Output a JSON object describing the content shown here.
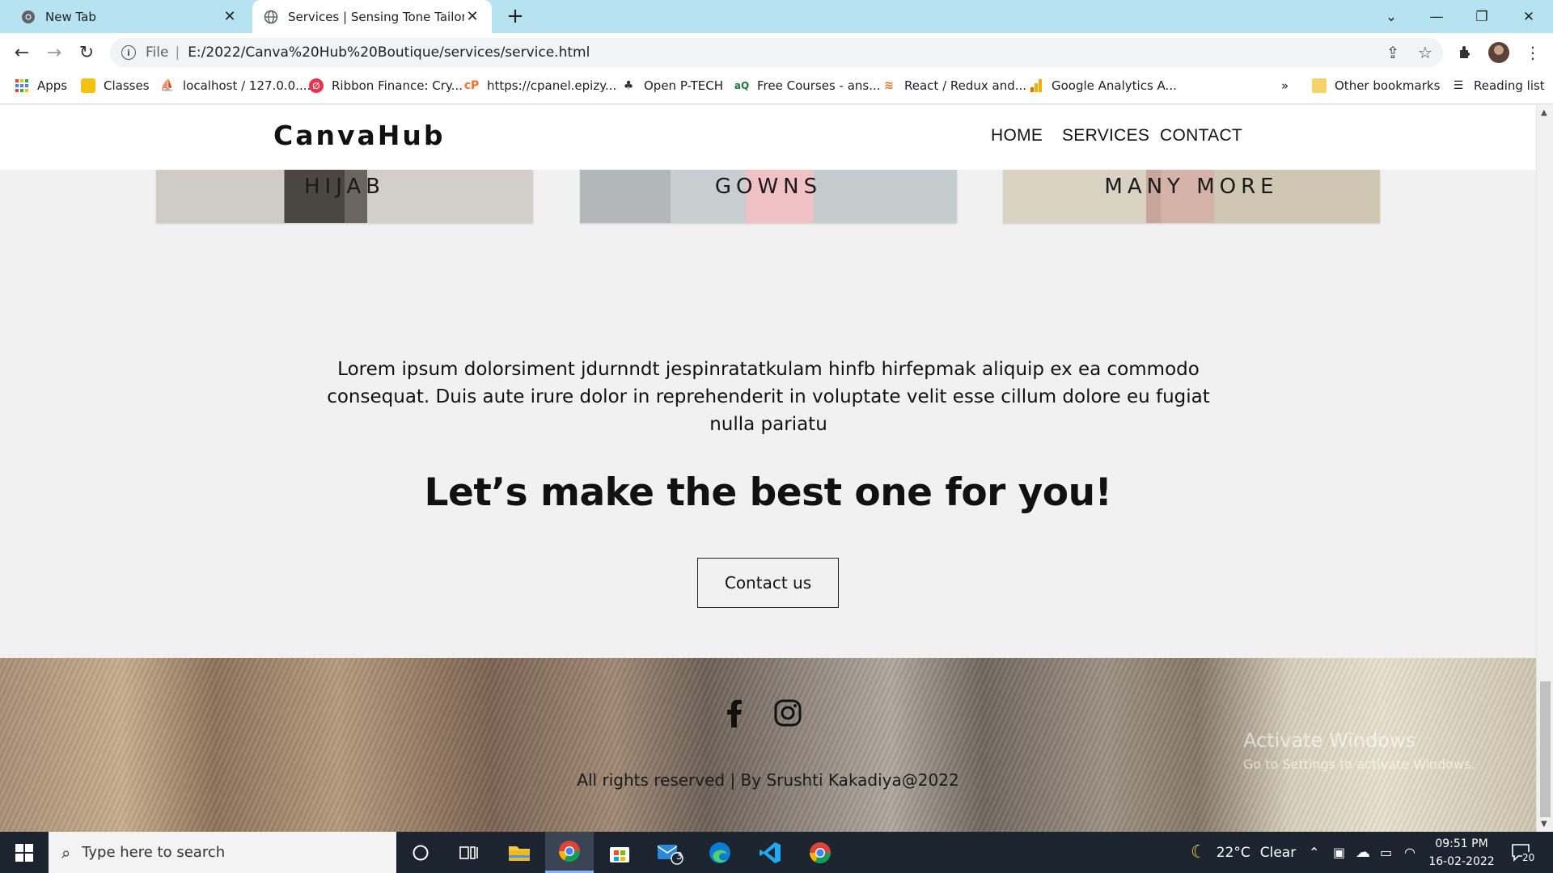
{
  "browser": {
    "tabs": [
      {
        "title": "New Tab",
        "active": false
      },
      {
        "title": "Services | Sensing Tone Tailors",
        "active": true
      }
    ],
    "address": {
      "scheme": "File",
      "url": "E:/2022/Canva%20Hub%20Boutique/services/service.html"
    },
    "bookmarks": [
      {
        "label": "Apps",
        "icon": "apps-grid-icon"
      },
      {
        "label": "Classes",
        "icon": "classes-icon"
      },
      {
        "label": "localhost / 127.0.0....",
        "icon": "phpmyadmin-icon"
      },
      {
        "label": "Ribbon Finance: Cry...",
        "icon": "ribbon-icon"
      },
      {
        "label": "https://cpanel.epizy...",
        "icon": "cpanel-icon"
      },
      {
        "label": "Open P-TECH",
        "icon": "ptech-icon"
      },
      {
        "label": "Free Courses - ans...",
        "icon": "courses-icon"
      },
      {
        "label": "React / Redux and...",
        "icon": "react-icon"
      },
      {
        "label": "Google Analytics A...",
        "icon": "analytics-icon"
      }
    ],
    "overflow": "»",
    "other_bookmarks": "Other bookmarks",
    "reading_list": "Reading list"
  },
  "site": {
    "logo": "CanvaHub",
    "nav": [
      "HOME",
      "SERVICES",
      "CONTACT"
    ],
    "cards": [
      "HIJAB",
      "GOWNS",
      "MANY MORE"
    ],
    "intro": "Lorem ipsum dolorsiment jdurnndt jespinratatkulam hinfb hirfepmak aliquip ex ea commodo consequat. Duis aute irure dolor in reprehenderit in voluptate velit esse cillum dolore eu fugiat nulla pariatu",
    "headline": "Let’s make the best one for you!",
    "cta": "Contact us",
    "footer": {
      "copyright": "All rights reserved | By Srushti Kakadiya@2022",
      "watermark_title": "Activate Windows",
      "watermark_sub": "Go to Settings to activate Windows."
    }
  },
  "taskbar": {
    "search_placeholder": "Type here to search",
    "mail_badge": "3",
    "weather": {
      "temp": "22°C",
      "condition": "Clear"
    },
    "time": "09:51 PM",
    "date": "16-02-2022",
    "notifications": "20"
  }
}
